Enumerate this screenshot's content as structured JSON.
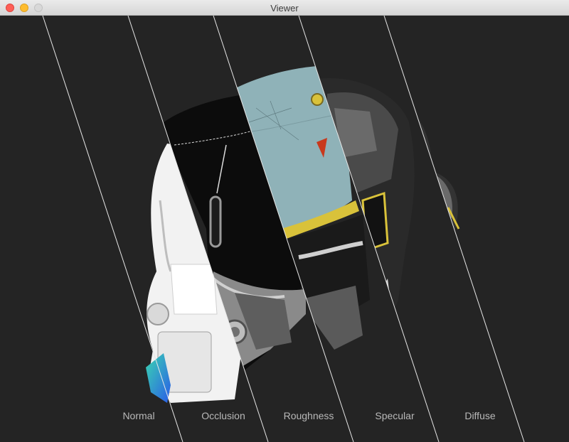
{
  "window": {
    "title": "Viewer",
    "buttons": [
      "close",
      "minimize",
      "zoom"
    ]
  },
  "viewer": {
    "model_icon": "helmet-model",
    "channels": [
      {
        "label": "Normal"
      },
      {
        "label": "Occlusion"
      },
      {
        "label": "Roughness"
      },
      {
        "label": "Specular"
      },
      {
        "label": "Diffuse"
      }
    ]
  },
  "colors": {
    "background": "#242424",
    "label_text": "#b9b9b9",
    "divider": "#e6e6e6",
    "visor_blue": "#8fb2b8",
    "accent_red": "#c8391c",
    "accent_yellow": "#d9c23a"
  }
}
